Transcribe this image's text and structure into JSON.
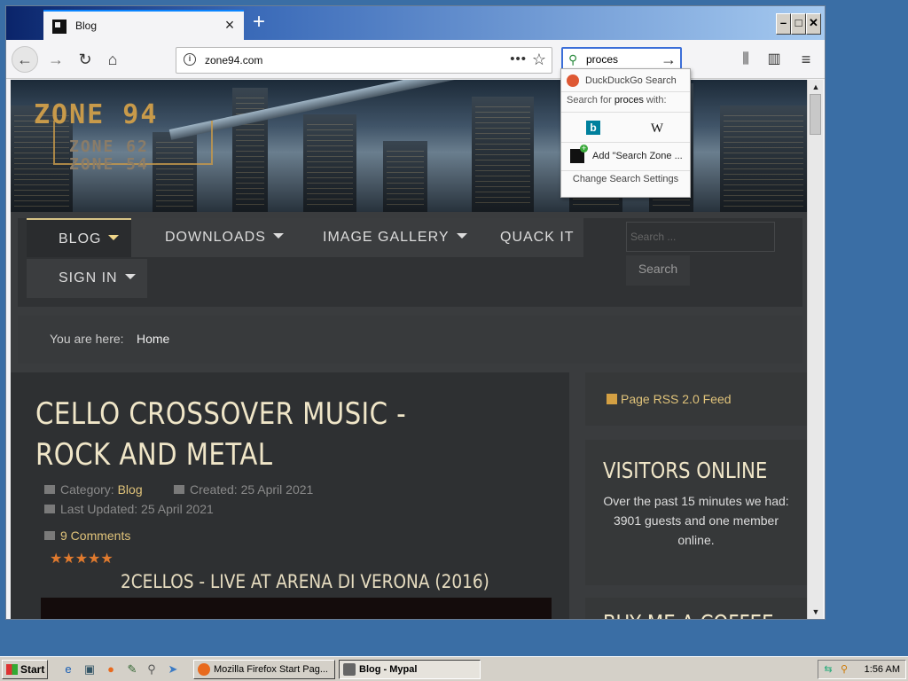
{
  "browser": {
    "tab_title": "Blog",
    "new_tab_label": "+",
    "url": "zone94.com",
    "search_query": "proces",
    "window_buttons": {
      "minimize": "–",
      "maximize": "□",
      "close": "✕"
    }
  },
  "search_popup": {
    "engine_name": "DuckDuckGo Search",
    "search_for_prefix": "Search for ",
    "search_for_term": "proces",
    "search_for_suffix": " with:",
    "engines": [
      {
        "name": "bing-icon",
        "glyph": "b"
      },
      {
        "name": "wikipedia-icon",
        "glyph": "W"
      }
    ],
    "add_engine_label": "Add \"Search Zone ...",
    "settings_label": "Change Search Settings"
  },
  "site": {
    "logo_line1": "ZONE 94",
    "logo_line2": "ZONE 62",
    "logo_line3": "ZONE 54",
    "menu": [
      {
        "label": "BLOG",
        "has_caret": true,
        "active": true
      },
      {
        "label": "DOWNLOADS",
        "has_caret": true
      },
      {
        "label": "IMAGE GALLERY",
        "has_caret": true
      },
      {
        "label": "QUACK IT",
        "has_caret": false
      },
      {
        "label": "SIGN IN",
        "has_caret": true
      }
    ],
    "search_placeholder": "Search ...",
    "search_button": "Search",
    "breadcrumb_label": "You are here:",
    "breadcrumb_home": "Home"
  },
  "article": {
    "title": "CELLO CROSSOVER MUSIC - ROCK AND METAL",
    "category_label": "Category:",
    "category_value": "Blog",
    "created": "Created: 25 April 2021",
    "updated": "Last Updated: 25 April 2021",
    "comments": "9 Comments",
    "rating": "★★★★★",
    "video_title": "2CELLOS - LIVE AT ARENA DI VERONA (2016)"
  },
  "sidebar": {
    "rss_label": "Page RSS 2.0 Feed",
    "visitors_title": "VISITORS ONLINE",
    "visitors_text_1": "Over the past 15 minutes we had:",
    "visitors_text_2": "3901 guests and one member online.",
    "coffee_title": "BUY ME A COFFEE"
  },
  "taskbar": {
    "start_label": "Start",
    "tasks": [
      {
        "label": "Mozilla Firefox Start Pag...",
        "active": false
      },
      {
        "label": "Blog - Mypal",
        "active": true
      }
    ],
    "clock": "1:56 AM"
  },
  "colors": {
    "accent": "#e0c37a",
    "title": "#f0e6c8",
    "bg_dark": "#2e3032",
    "star": "#e07a2e"
  }
}
